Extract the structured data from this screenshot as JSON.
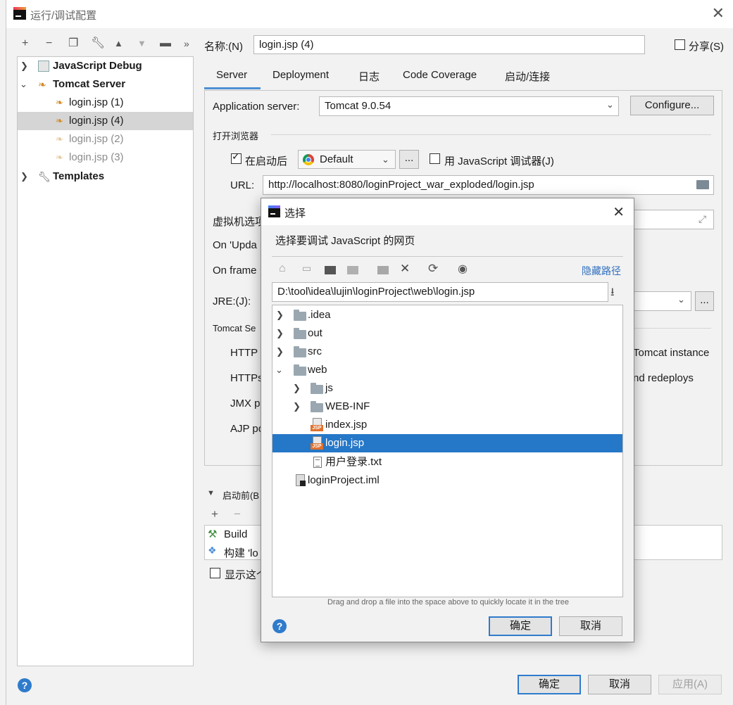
{
  "window": {
    "title": "运行/调试配置"
  },
  "left_tree": {
    "items": [
      {
        "label": "JavaScript Debug"
      },
      {
        "label": "Tomcat Server"
      },
      {
        "label": "login.jsp (1)"
      },
      {
        "label": "login.jsp (4)"
      },
      {
        "label": "login.jsp (2)"
      },
      {
        "label": "login.jsp (3)"
      },
      {
        "label": "Templates"
      }
    ]
  },
  "form": {
    "name_label": "名称:(N)",
    "name_value": "login.jsp (4)",
    "share_label": "分享(S)",
    "tabs": [
      "Server",
      "Deployment",
      "日志",
      "Code Coverage",
      "启动/连接"
    ],
    "app_server_label": "Application server:",
    "app_server_value": "Tomcat 9.0.54",
    "configure_button": "Configure...",
    "open_browser_label": "打开浏览器",
    "after_launch_label": "在启动后",
    "browser_value": "Default",
    "ellipsis": "...",
    "js_debugger_label": "用 JavaScript 调试器(J)",
    "url_label": "URL:",
    "url_value": "http://localhost:8080/loginProject_war_exploded/login.jsp",
    "vm_options_label": "虚拟机选项",
    "on_update_label": "On 'Upda",
    "on_frame_label": "On frame",
    "jre_label": "JRE:(J):",
    "tomcat_settings_label": "Tomcat Se",
    "http_label": "HTTP",
    "https_label": "HTTPs",
    "jmx_label": "JMX p",
    "ajp_label": "AJP po",
    "tomcat_instance_text": "Tomcat instance",
    "redeploys_text": "nd redeploys",
    "before_launch_label": "启动前(B",
    "before_items": [
      "Build",
      "构建 'lo"
    ],
    "show_page_label": "显示这个"
  },
  "bottom_buttons": {
    "ok": "确定",
    "cancel": "取消",
    "apply": "应用(A)"
  },
  "dialog": {
    "title": "选择",
    "prompt": "选择要调试 JavaScript 的网页",
    "hide_path": "隐藏路径",
    "path_value": "D:\\tool\\idea\\lujin\\loginProject\\web\\login.jsp",
    "tree": [
      {
        "label": ".idea"
      },
      {
        "label": "out"
      },
      {
        "label": "src"
      },
      {
        "label": "web"
      },
      {
        "label": "js"
      },
      {
        "label": "WEB-INF"
      },
      {
        "label": "index.jsp"
      },
      {
        "label": "login.jsp"
      },
      {
        "label": "用户登录.txt"
      },
      {
        "label": "loginProject.iml"
      }
    ],
    "hint": "Drag and drop a file into the space above to quickly locate it in the tree",
    "ok": "确定",
    "cancel": "取消"
  },
  "colors": {
    "selection": "#2577c7",
    "accent": "#2f7bcc"
  }
}
